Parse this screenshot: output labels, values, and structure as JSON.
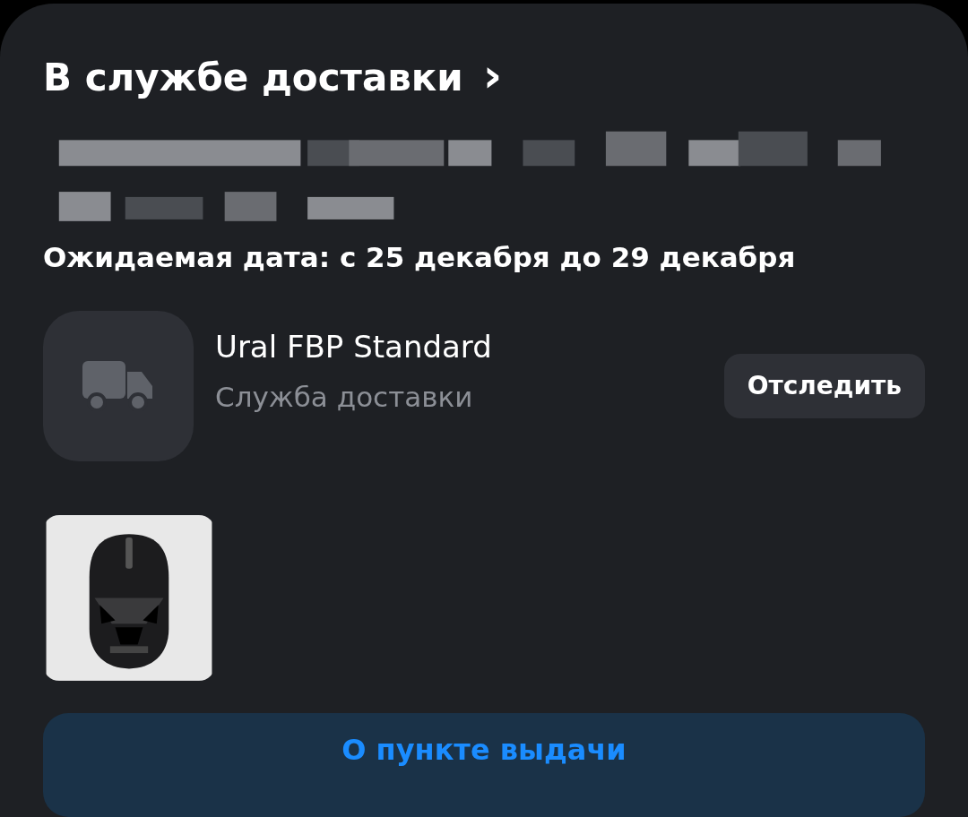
{
  "section": {
    "title": "В службе доставки",
    "chevron": "›"
  },
  "expected_date": "Ожидаемая дата: с 25 декабря до 29 декабря",
  "carrier": {
    "name": "Ural FBP Standard",
    "subtitle": "Служба доставки",
    "track_button": "Отследить"
  },
  "pickup_button": "О пункте выдачи"
}
